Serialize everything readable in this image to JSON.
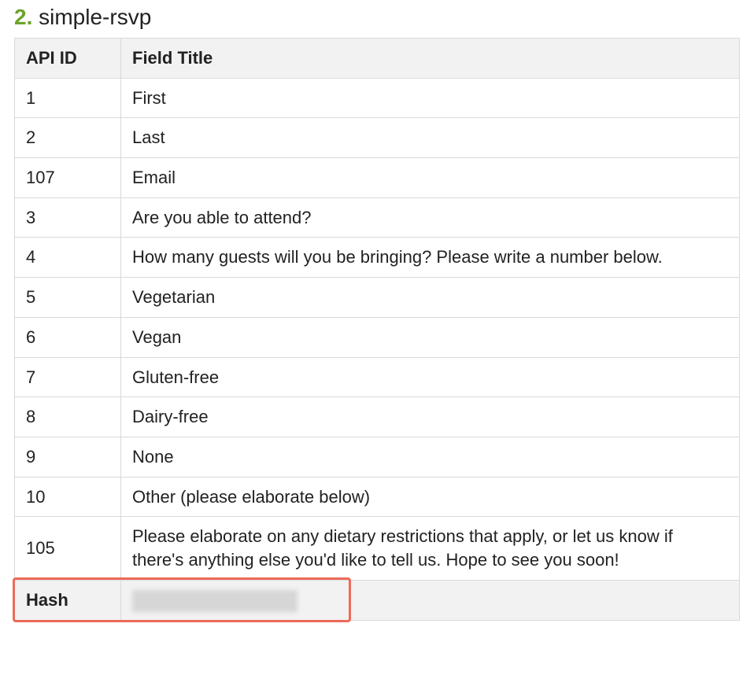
{
  "heading": {
    "number": "2.",
    "name": "simple-rsvp"
  },
  "table": {
    "headers": {
      "api_id": "API ID",
      "field_title": "Field Title"
    },
    "rows": [
      {
        "api_id": "1",
        "field_title": "First"
      },
      {
        "api_id": "2",
        "field_title": "Last"
      },
      {
        "api_id": "107",
        "field_title": "Email"
      },
      {
        "api_id": "3",
        "field_title": "Are you able to attend?"
      },
      {
        "api_id": "4",
        "field_title": "How many guests will you be bringing? Please write a number below."
      },
      {
        "api_id": "5",
        "field_title": "Vegetarian"
      },
      {
        "api_id": "6",
        "field_title": "Vegan"
      },
      {
        "api_id": "7",
        "field_title": "Gluten-free"
      },
      {
        "api_id": "8",
        "field_title": "Dairy-free"
      },
      {
        "api_id": "9",
        "field_title": "None"
      },
      {
        "api_id": "10",
        "field_title": "Other (please elaborate below)"
      },
      {
        "api_id": "105",
        "field_title": "Please elaborate on any dietary restrictions that apply, or let us know if there's anything else you'd like to tell us. Hope to see you soon!"
      }
    ],
    "hash_row": {
      "label": "Hash"
    }
  }
}
